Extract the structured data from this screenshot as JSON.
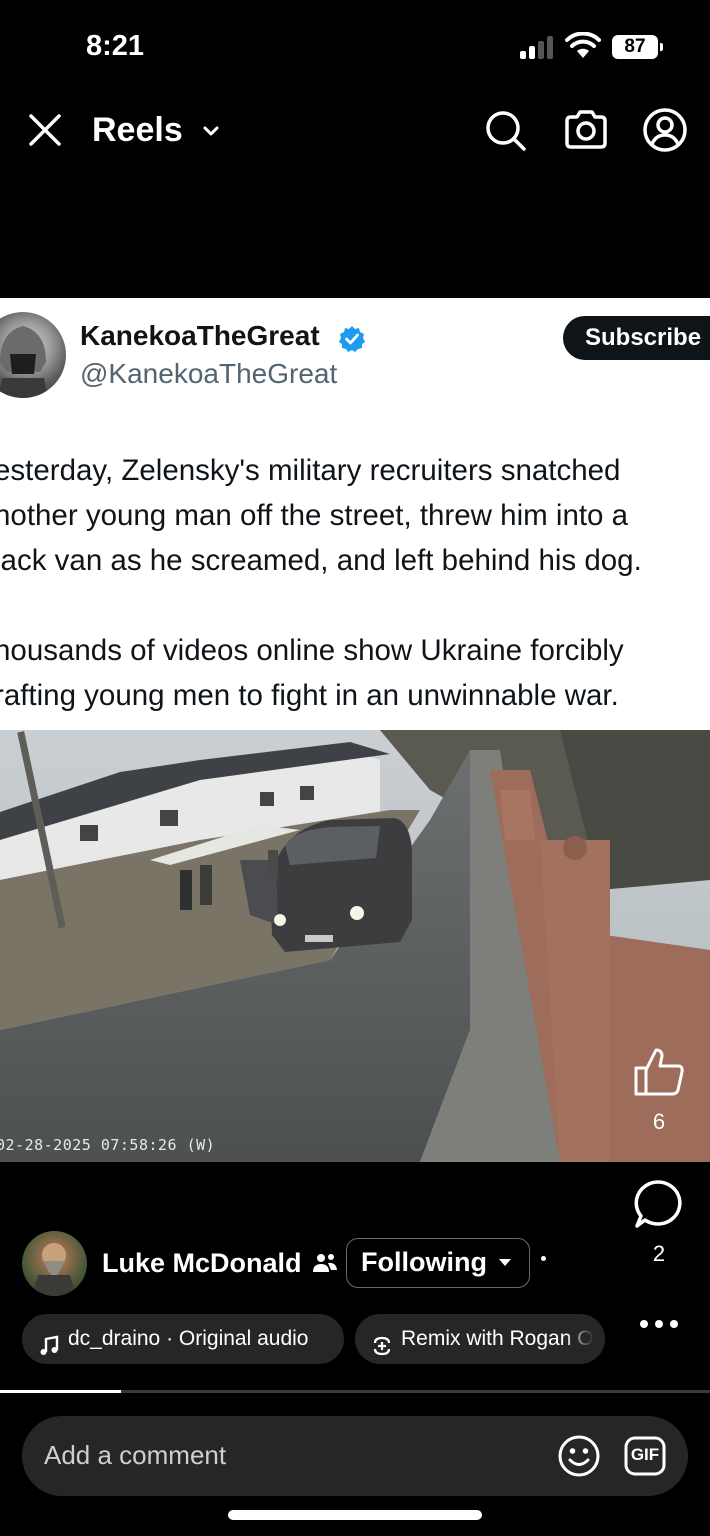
{
  "status_bar": {
    "time": "8:21",
    "battery": "87"
  },
  "header": {
    "title": "Reels",
    "icons": [
      "close-icon",
      "chevron-down-icon",
      "search-icon",
      "camera-icon",
      "profile-icon"
    ]
  },
  "post": {
    "name": "KanekoaTheGreat",
    "handle": "@KanekoaTheGreat",
    "subscribe_label": "Subscribe",
    "lines": [
      "esterday, Zelensky's military recruiters snatched",
      "nother young man off the street, threw him into a",
      "lack van as he screamed, and left behind his dog.",
      "housands of videos online show Ukraine forcibly",
      "rafting young men to fight in an unwinnable war."
    ]
  },
  "video": {
    "timestamp": "02-28-2025 07:58:26 (W)"
  },
  "actions": {
    "likes": "6",
    "comments": "2"
  },
  "author": {
    "name": "Luke McDonald",
    "following_label": "Following"
  },
  "audio": {
    "label": "dc_draino · Original audio",
    "remix_label": "Remix with Rogan O"
  },
  "progress": {
    "fraction": 0.17
  },
  "comment": {
    "placeholder": "Add a comment",
    "gif_label": "GIF"
  }
}
